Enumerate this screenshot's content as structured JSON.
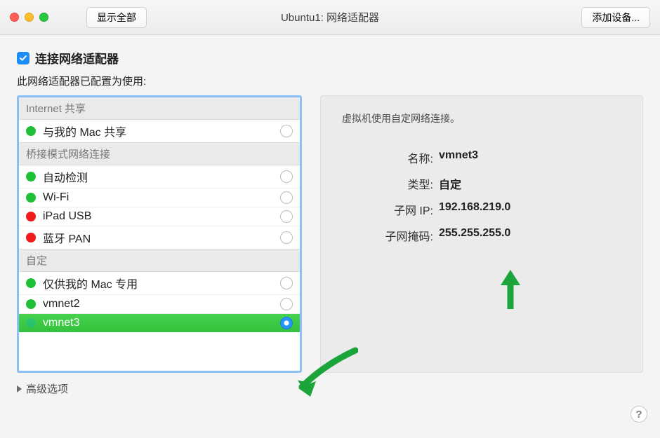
{
  "titlebar": {
    "show_all": "显示全部",
    "title": "Ubuntu1: 网络适配器",
    "add_device": "添加设备..."
  },
  "checkbox_label": "连接网络适配器",
  "config_label": "此网络适配器已配置为使用:",
  "groups": {
    "internet_share": "Internet 共享",
    "bridged": "桥接模式网络连接",
    "custom": "自定"
  },
  "items": {
    "share_mac": "与我的 Mac 共享",
    "autodetect": "自动检测",
    "wifi": "Wi-Fi",
    "ipad_usb": "iPad USB",
    "bt_pan": "蓝牙 PAN",
    "mac_only": "仅供我的 Mac 专用",
    "vmnet2": "vmnet2",
    "vmnet3": "vmnet3"
  },
  "advanced": "高级选项",
  "info": {
    "desc": "虚拟机使用自定网络连接。",
    "name_label": "名称:",
    "name_value": "vmnet3",
    "type_label": "类型:",
    "type_value": "自定",
    "subnet_ip_label": "子网 IP:",
    "subnet_ip_value": "192.168.219.0",
    "subnet_mask_label": "子网掩码:",
    "subnet_mask_value": "255.255.255.0"
  },
  "help": "?"
}
